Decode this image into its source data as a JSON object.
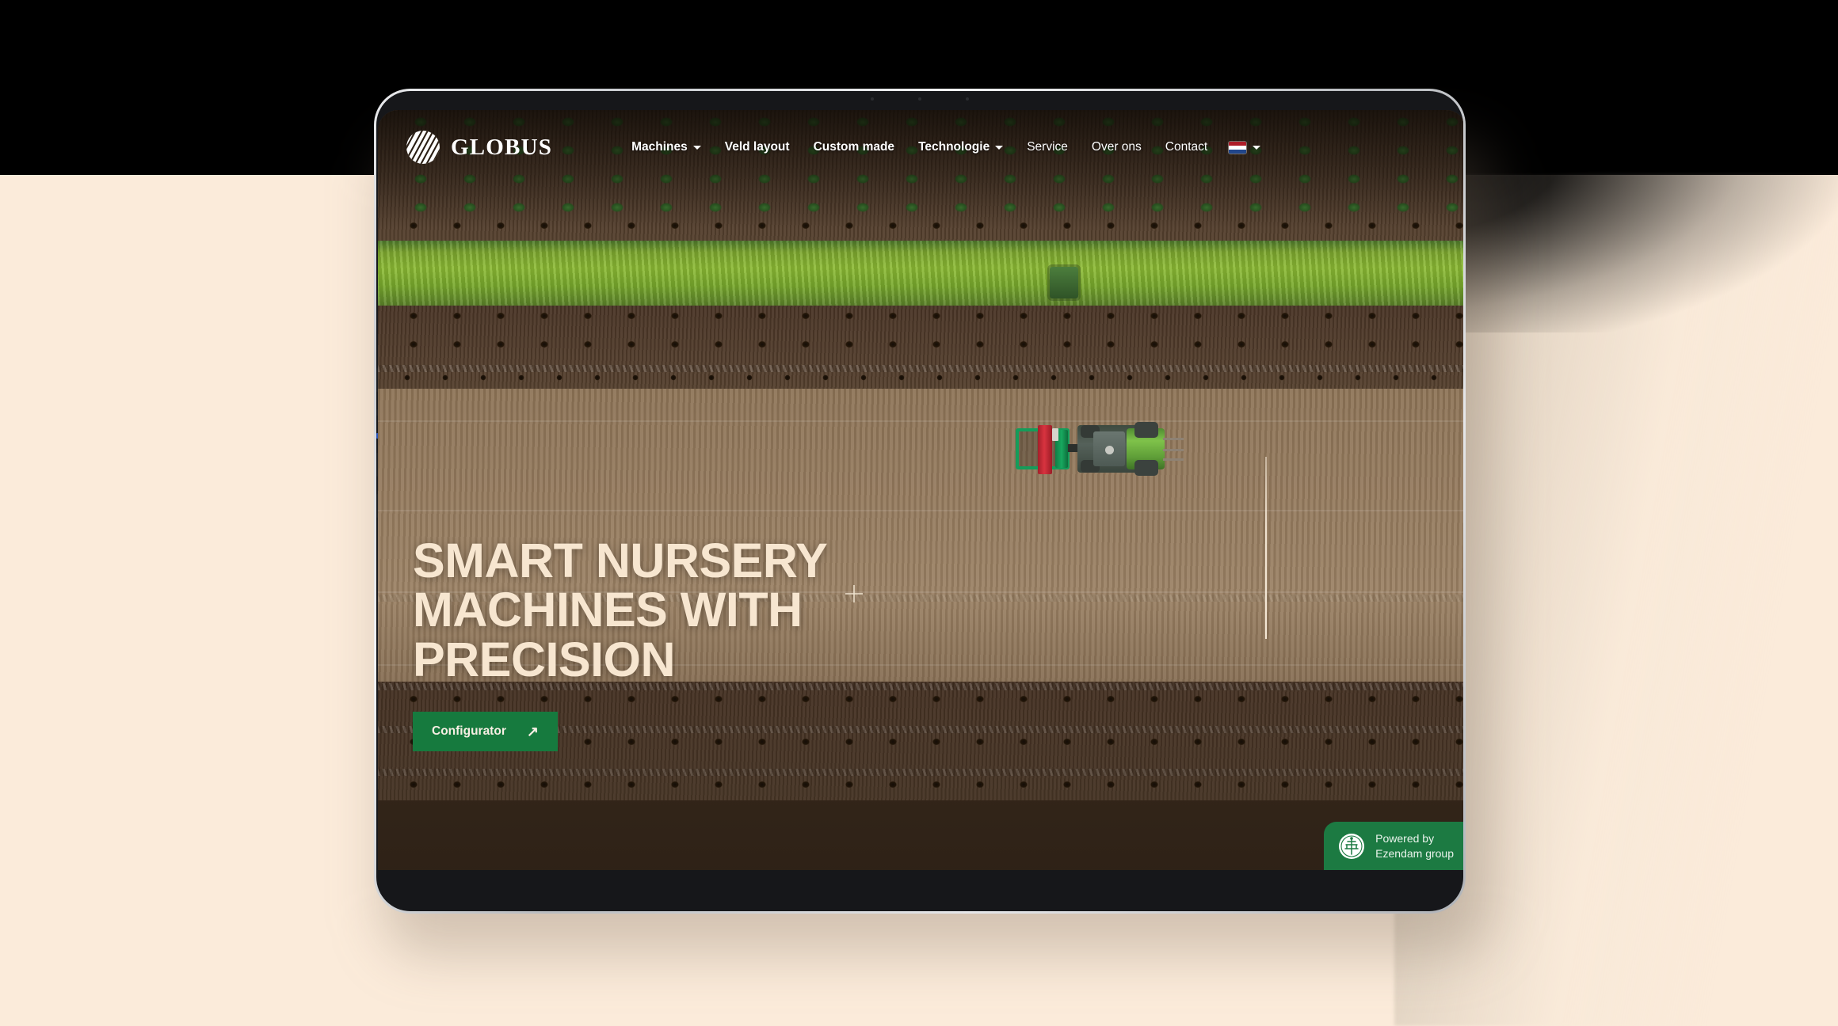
{
  "site": {
    "brand": {
      "name": "GLOBUS",
      "logo_icon": "globe-stripes-icon"
    },
    "nav": {
      "items": [
        {
          "label": "Machines",
          "icon": "chevron-down-icon",
          "has_dropdown": true,
          "weight": "bold"
        },
        {
          "label": "Veld layout",
          "has_dropdown": false,
          "weight": "bold"
        },
        {
          "label": "Custom made",
          "has_dropdown": false,
          "weight": "bold"
        },
        {
          "label": "Technologie",
          "icon": "chevron-down-icon",
          "has_dropdown": true,
          "weight": "bold"
        },
        {
          "label": "Service",
          "has_dropdown": false,
          "weight": "light"
        },
        {
          "label": "Over ons",
          "has_dropdown": false,
          "weight": "light"
        },
        {
          "label": "Contact",
          "has_dropdown": false,
          "weight": "light"
        }
      ],
      "language": {
        "flag_icon": "flag-netherlands-icon",
        "caret_icon": "chevron-down-icon"
      }
    },
    "hero": {
      "title": "SMART NURSERY MACHINES WITH PRECISION",
      "cta_label": "Configurator",
      "cta_icon": "arrow-up-right-icon"
    },
    "badge": {
      "logo_icon": "ezendam-tree-emblem-icon",
      "line1": "Powered by",
      "line2": "Ezendam group"
    }
  },
  "colors": {
    "page_top": "#000000",
    "page_bottom": "#FBEBDA",
    "brand_green": "#167A3E",
    "badge_green": "#1C7A42",
    "hero_cream": "#F7E6D0",
    "nav_text": "#FFFFFF"
  }
}
